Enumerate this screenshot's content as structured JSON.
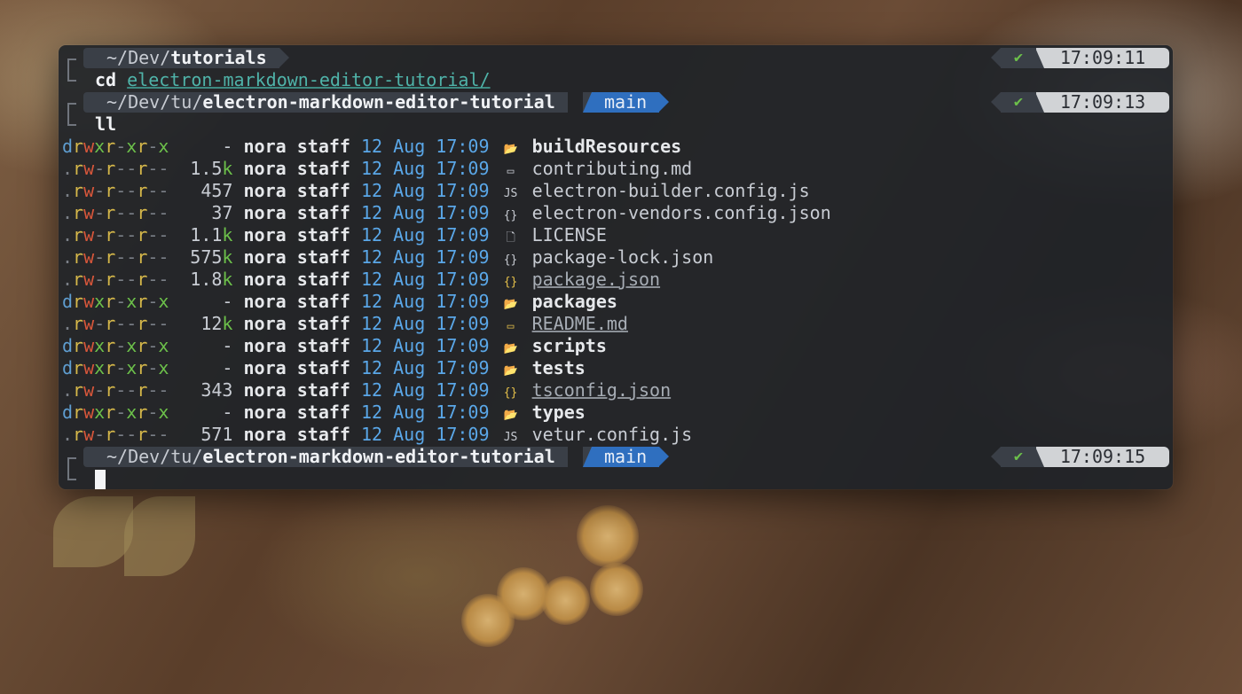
{
  "prompts": [
    {
      "dir_prefix": "~/Dev/",
      "dir_bold": "tutorials",
      "branch": "",
      "status": "✔",
      "time": "17:09:11"
    },
    {
      "dir_prefix": "~/Dev/tu/",
      "dir_bold": "electron-markdown-editor-tutorial",
      "branch": "main",
      "status": "✔",
      "time": "17:09:13"
    },
    {
      "dir_prefix": "~/Dev/tu/",
      "dir_bold": "electron-markdown-editor-tutorial",
      "branch": "main",
      "status": "✔",
      "time": "17:09:15"
    }
  ],
  "commands": [
    {
      "cmd": "cd",
      "arg": "electron-markdown-editor-tutorial/"
    },
    {
      "cmd": "ll",
      "arg": ""
    }
  ],
  "listing": [
    {
      "type": "d",
      "perms": "rwxr-xr-x",
      "size": "-",
      "unit": "",
      "user": "nora",
      "group": "staff",
      "day": "12",
      "month": "Aug",
      "time": "17:09",
      "icon": "📂",
      "icon_name": "folder-icon",
      "name": "buildResources",
      "kind": "dir"
    },
    {
      "type": ".",
      "perms": "rw-r--r--",
      "size": "1.5",
      "unit": "k",
      "user": "nora",
      "group": "staff",
      "day": "12",
      "month": "Aug",
      "time": "17:09",
      "icon": "▭",
      "icon_name": "markdown-icon",
      "name": "contributing.md",
      "kind": "file"
    },
    {
      "type": ".",
      "perms": "rw-r--r--",
      "size": "457",
      "unit": "",
      "user": "nora",
      "group": "staff",
      "day": "12",
      "month": "Aug",
      "time": "17:09",
      "icon": "JS",
      "icon_name": "js-icon",
      "name": "electron-builder.config.js",
      "kind": "file"
    },
    {
      "type": ".",
      "perms": "rw-r--r--",
      "size": "37",
      "unit": "",
      "user": "nora",
      "group": "staff",
      "day": "12",
      "month": "Aug",
      "time": "17:09",
      "icon": "{}",
      "icon_name": "json-icon",
      "name": "electron-vendors.config.json",
      "kind": "file"
    },
    {
      "type": ".",
      "perms": "rw-r--r--",
      "size": "1.1",
      "unit": "k",
      "user": "nora",
      "group": "staff",
      "day": "12",
      "month": "Aug",
      "time": "17:09",
      "icon": "🗋",
      "icon_name": "license-file-icon",
      "name": "LICENSE",
      "kind": "file"
    },
    {
      "type": ".",
      "perms": "rw-r--r--",
      "size": "575",
      "unit": "k",
      "user": "nora",
      "group": "staff",
      "day": "12",
      "month": "Aug",
      "time": "17:09",
      "icon": "{}",
      "icon_name": "json-icon",
      "name": "package-lock.json",
      "kind": "file"
    },
    {
      "type": ".",
      "perms": "rw-r--r--",
      "size": "1.8",
      "unit": "k",
      "user": "nora",
      "group": "staff",
      "day": "12",
      "month": "Aug",
      "time": "17:09",
      "icon": "{}",
      "icon_name": "json-icon",
      "name": "package.json",
      "kind": "special"
    },
    {
      "type": "d",
      "perms": "rwxr-xr-x",
      "size": "-",
      "unit": "",
      "user": "nora",
      "group": "staff",
      "day": "12",
      "month": "Aug",
      "time": "17:09",
      "icon": "📂",
      "icon_name": "folder-icon",
      "name": "packages",
      "kind": "dir"
    },
    {
      "type": ".",
      "perms": "rw-r--r--",
      "size": "12",
      "unit": "k",
      "user": "nora",
      "group": "staff",
      "day": "12",
      "month": "Aug",
      "time": "17:09",
      "icon": "▭",
      "icon_name": "markdown-icon",
      "name": "README.md",
      "kind": "special"
    },
    {
      "type": "d",
      "perms": "rwxr-xr-x",
      "size": "-",
      "unit": "",
      "user": "nora",
      "group": "staff",
      "day": "12",
      "month": "Aug",
      "time": "17:09",
      "icon": "📂",
      "icon_name": "folder-icon",
      "name": "scripts",
      "kind": "dir"
    },
    {
      "type": "d",
      "perms": "rwxr-xr-x",
      "size": "-",
      "unit": "",
      "user": "nora",
      "group": "staff",
      "day": "12",
      "month": "Aug",
      "time": "17:09",
      "icon": "📂",
      "icon_name": "folder-icon",
      "name": "tests",
      "kind": "dir"
    },
    {
      "type": ".",
      "perms": "rw-r--r--",
      "size": "343",
      "unit": "",
      "user": "nora",
      "group": "staff",
      "day": "12",
      "month": "Aug",
      "time": "17:09",
      "icon": "{}",
      "icon_name": "json-icon",
      "name": "tsconfig.json",
      "kind": "special"
    },
    {
      "type": "d",
      "perms": "rwxr-xr-x",
      "size": "-",
      "unit": "",
      "user": "nora",
      "group": "staff",
      "day": "12",
      "month": "Aug",
      "time": "17:09",
      "icon": "📂",
      "icon_name": "folder-icon",
      "name": "types",
      "kind": "dir"
    },
    {
      "type": ".",
      "perms": "rw-r--r--",
      "size": "571",
      "unit": "",
      "user": "nora",
      "group": "staff",
      "day": "12",
      "month": "Aug",
      "time": "17:09",
      "icon": "JS",
      "icon_name": "js-icon",
      "name": "vetur.config.js",
      "kind": "file"
    }
  ],
  "colors": {
    "branch_bg": "#2f6fbf",
    "date": "#5aa7e8",
    "status_ok": "#6cc04a",
    "perm_write": "#d9573b",
    "perm_read": "#d6b84a"
  }
}
